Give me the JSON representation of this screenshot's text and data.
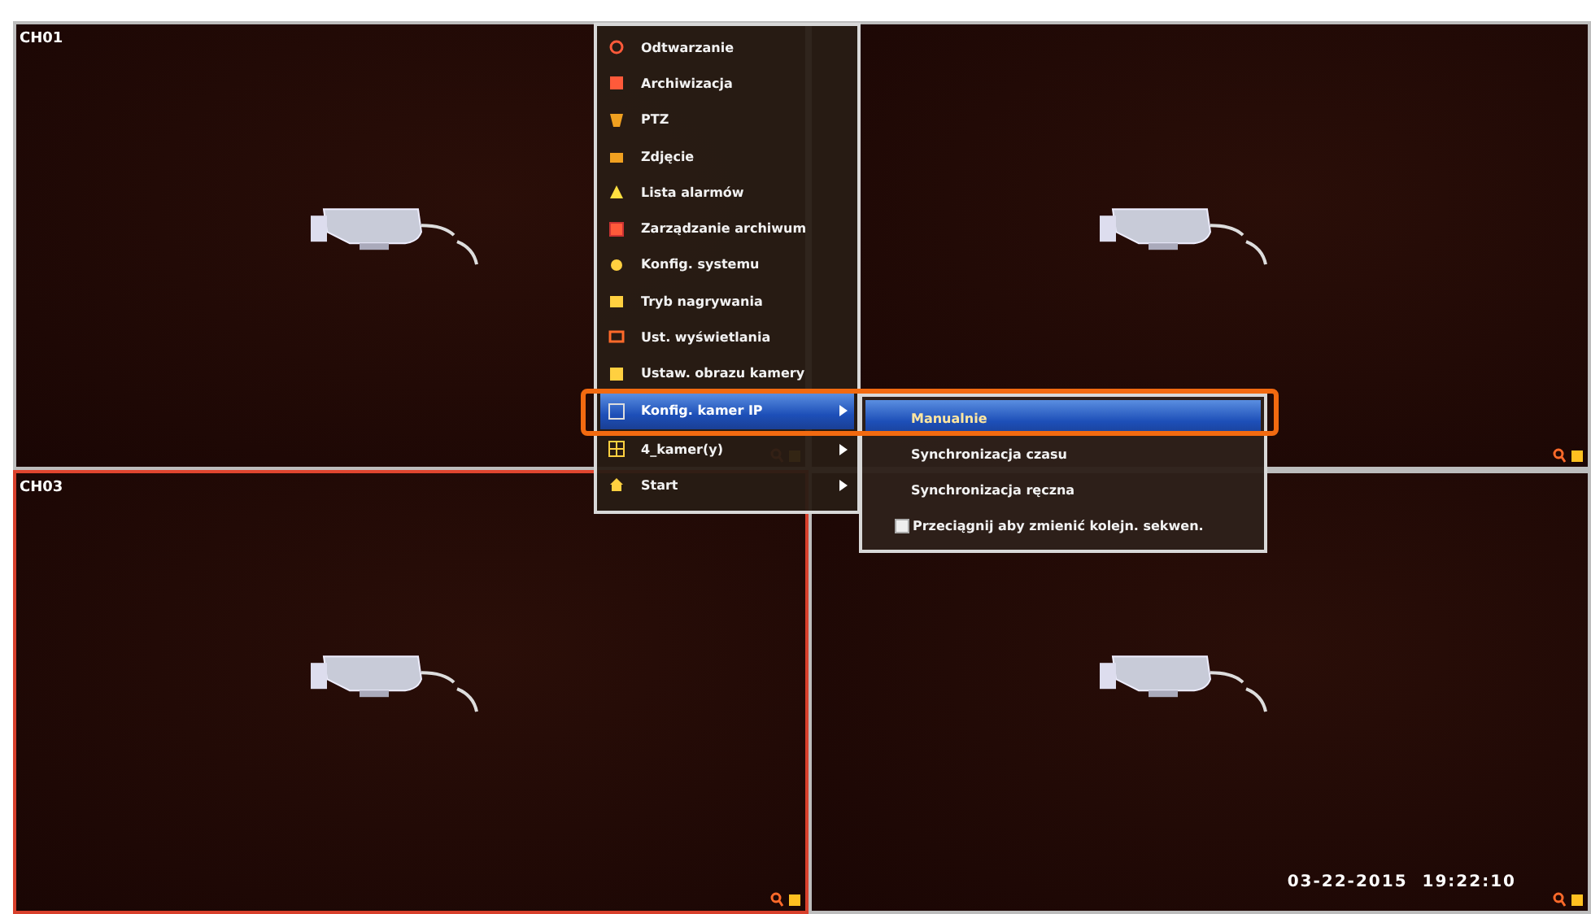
{
  "tiles": [
    {
      "label": "CH01",
      "selected": false
    },
    {
      "selected": false
    },
    {
      "label": "CH03",
      "selected": true
    },
    {
      "selected": false,
      "timestamp": "03-22-2015  19:22:10"
    }
  ],
  "menu": {
    "items": [
      {
        "label": "Odtwarzanie",
        "selected": false,
        "has_submenu": false
      },
      {
        "label": "Archiwizacja",
        "selected": false,
        "has_submenu": false
      },
      {
        "label": "PTZ",
        "selected": false,
        "has_submenu": false
      },
      {
        "label": "Zdjęcie",
        "selected": false,
        "has_submenu": false
      },
      {
        "label": "Lista alarmów",
        "selected": false,
        "has_submenu": false
      },
      {
        "label": "Zarządzanie archiwum",
        "selected": false,
        "has_submenu": false
      },
      {
        "label": "Konfig. systemu",
        "selected": false,
        "has_submenu": false
      },
      {
        "label": "Tryb nagrywania",
        "selected": false,
        "has_submenu": false
      },
      {
        "label": "Ust. wyświetlania",
        "selected": false,
        "has_submenu": false
      },
      {
        "label": "Ustaw. obrazu kamery",
        "selected": false,
        "has_submenu": false
      },
      {
        "label": "Konfig. kamer IP",
        "selected": true,
        "has_submenu": true
      },
      {
        "label": "4_kamer(y)",
        "selected": false,
        "has_submenu": true
      },
      {
        "label": "Start",
        "selected": false,
        "has_submenu": true
      }
    ]
  },
  "submenu": {
    "items": [
      {
        "kind": "action",
        "label": "Manualnie",
        "selected": true
      },
      {
        "kind": "action",
        "label": "Synchronizacja czasu",
        "selected": false
      },
      {
        "kind": "action",
        "label": "Synchronizacja ręczna",
        "selected": false
      },
      {
        "kind": "checkbox",
        "label": "Przeciągnij aby zmienić kolejn. sekwen.",
        "checked": false
      }
    ]
  }
}
